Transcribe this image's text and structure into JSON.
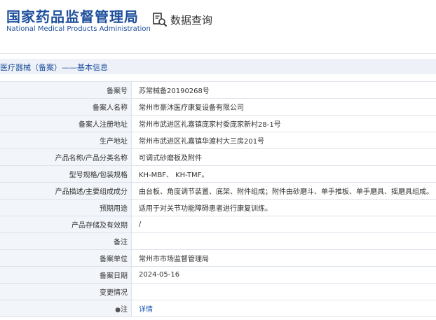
{
  "header": {
    "logo_cn": "国家药品监督管理局",
    "logo_en": "National Medical Products Administration",
    "query_title": "数据查询",
    "query_icon": "document-search-icon"
  },
  "breadcrumb": "医疗器械（备案）——基本信息",
  "colors": {
    "brand": "#1e4f9c",
    "label_bg": "#f2f5fa",
    "link": "#1e5cb8"
  },
  "rows": [
    {
      "label": "备案号",
      "value": "苏常械备20190268号"
    },
    {
      "label": "备案人名称",
      "value": "常州市豪沐医疗康复设备有限公司"
    },
    {
      "label": "备案人注册地址",
      "value": "常州市武进区礼嘉镇庞家村委庞家新村28-1号"
    },
    {
      "label": "生产地址",
      "value": "常州市武进区礼嘉镇华渡村大三房201号"
    },
    {
      "label": "产品名称/产品分类名称",
      "value": "可调式砂磨板及附件"
    },
    {
      "label": "型号规格/包装规格",
      "value": "KH-MBF、 KH-TMF。"
    },
    {
      "label": "产品描述/主要组成成分",
      "value": "由台板、角度调节装置、底架、附件组成；附件由砂磨斗、单手推板、单手磨具、摇磨具组成。"
    },
    {
      "label": "预期用途",
      "value": "适用于对关节功能障碍患者进行康复训练。"
    },
    {
      "label": "产品存储及有效期",
      "value": "/"
    },
    {
      "label": "备注",
      "value": ""
    },
    {
      "label": "备案单位",
      "value": "常州市市场监督管理局"
    },
    {
      "label": "备案日期",
      "value": "2024-05-16"
    },
    {
      "label": "变更情况",
      "value": ""
    }
  ],
  "note_row": {
    "label": "注",
    "link": "详情",
    "icon": "pin-icon"
  }
}
